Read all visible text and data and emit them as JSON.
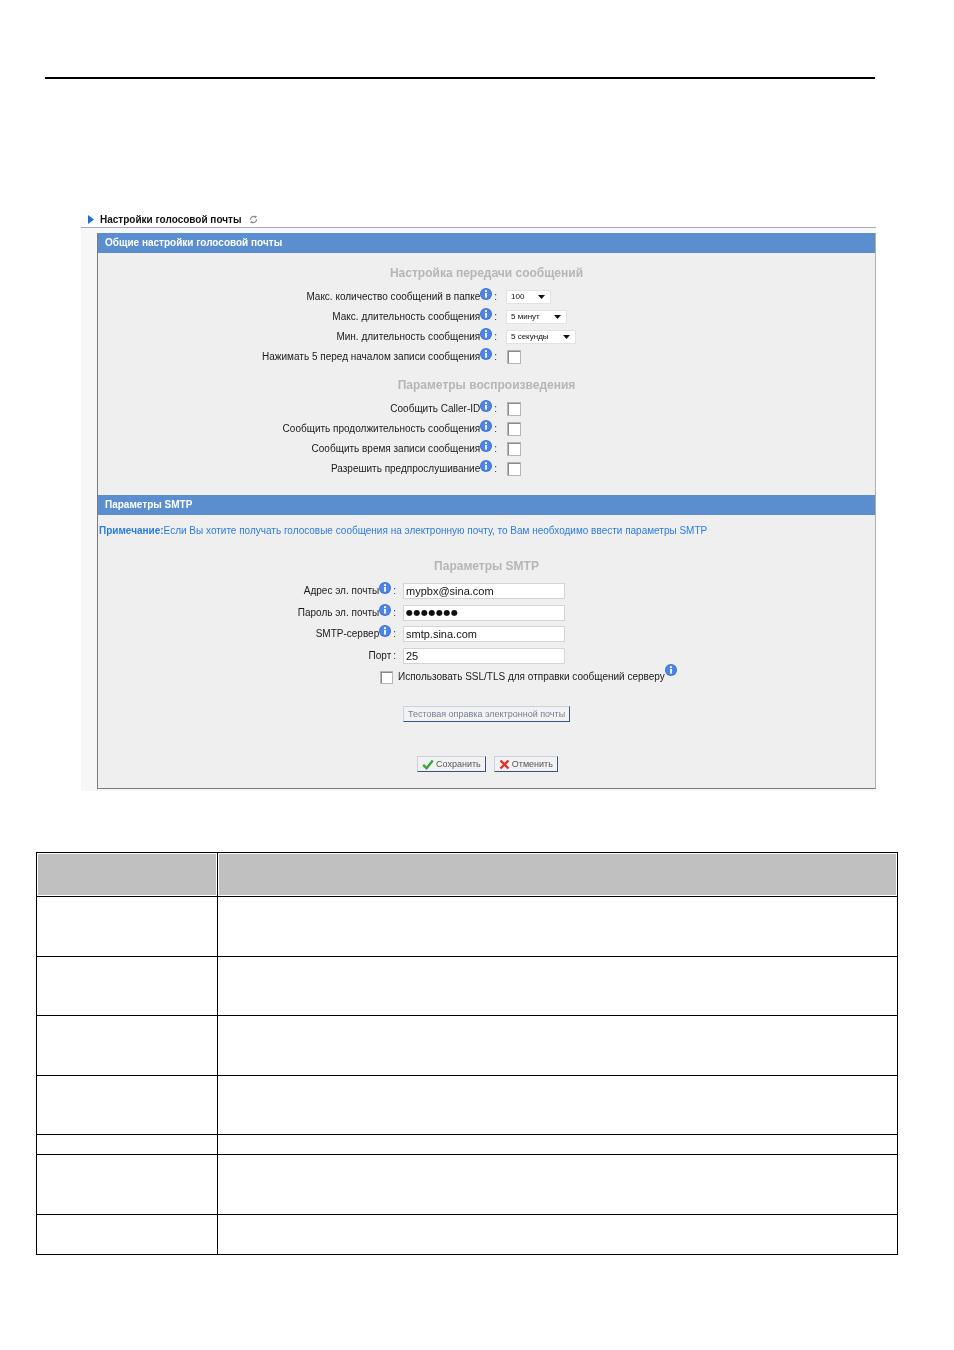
{
  "breadcrumb": {
    "title": "Настройки голосовой почты"
  },
  "panels": [
    {
      "title": "Общие настройки голосовой почты",
      "sections": [
        {
          "heading": "Настройка передачи сообщений",
          "rows": [
            {
              "kind": "select",
              "label": "Макс. количество сообщений в папке",
              "info": true,
              "separator": ":",
              "value": "100"
            },
            {
              "kind": "select",
              "label": "Макс. длительность сообщения",
              "info": true,
              "separator": ":",
              "value": "5 минут"
            },
            {
              "kind": "select",
              "label": "Мин. длительность сообщения",
              "info": true,
              "separator": ":",
              "value": "5 секунды"
            },
            {
              "kind": "checkbox",
              "label": "Нажимать 5 перед началом записи сообщения",
              "info": true,
              "separator": ":",
              "checked": false
            }
          ]
        },
        {
          "heading": "Параметры воспроизведения",
          "rows": [
            {
              "kind": "checkbox",
              "label": "Сообщить Caller-ID",
              "info": true,
              "separator": ":",
              "checked": false
            },
            {
              "kind": "checkbox",
              "label": "Сообщить продолжительность сообщения",
              "info": true,
              "separator": ":",
              "checked": false
            },
            {
              "kind": "checkbox",
              "label": "Сообщить время записи сообщения",
              "info": true,
              "separator": ":",
              "checked": false
            },
            {
              "kind": "checkbox",
              "label": "Разрешить предпрослушивание",
              "info": true,
              "separator": ":",
              "checked": false
            }
          ]
        }
      ]
    },
    {
      "title": "Параметры SMTP",
      "note": "**Примечание:**Если Вы хотите получать голосовые сообщения на электронную почту, то Вам необходимо ввести параметры SMTP",
      "sections": [
        {
          "heading": "Параметры SMTP",
          "rows": [
            {
              "kind": "text",
              "label": "Адрес эл. почты",
              "info": true,
              "separator": ":",
              "value": "mypbx@sina.com"
            },
            {
              "kind": "password",
              "label": "Пароль эл. почты",
              "info": true,
              "separator": ":",
              "value": "●●●●●●●"
            },
            {
              "kind": "text",
              "label": "SMTP-сервер",
              "info": true,
              "separator": ":",
              "value": "smtp.sina.com"
            },
            {
              "kind": "text",
              "label": "Порт",
              "info": false,
              "separator": ":",
              "value": "25"
            },
            {
              "kind": "inline_checkbox",
              "label": "Использовать SSL/TLS для отправки сообщений серверу",
              "info": true,
              "checked": false
            }
          ]
        }
      ],
      "test_button": {
        "label": "Тестовая оправка электронной почты"
      },
      "actions": [
        {
          "kind": "save",
          "label": "Сохранить"
        },
        {
          "kind": "cancel",
          "label": "Отменить"
        }
      ]
    }
  ],
  "table": {
    "rows": [
      {
        "kind": "header"
      },
      {
        "kind": "tall"
      },
      {
        "kind": "tall"
      },
      {
        "kind": "tall"
      },
      {
        "kind": "tall"
      },
      {
        "kind": "thin"
      },
      {
        "kind": "tall"
      },
      {
        "kind": "short"
      }
    ]
  }
}
